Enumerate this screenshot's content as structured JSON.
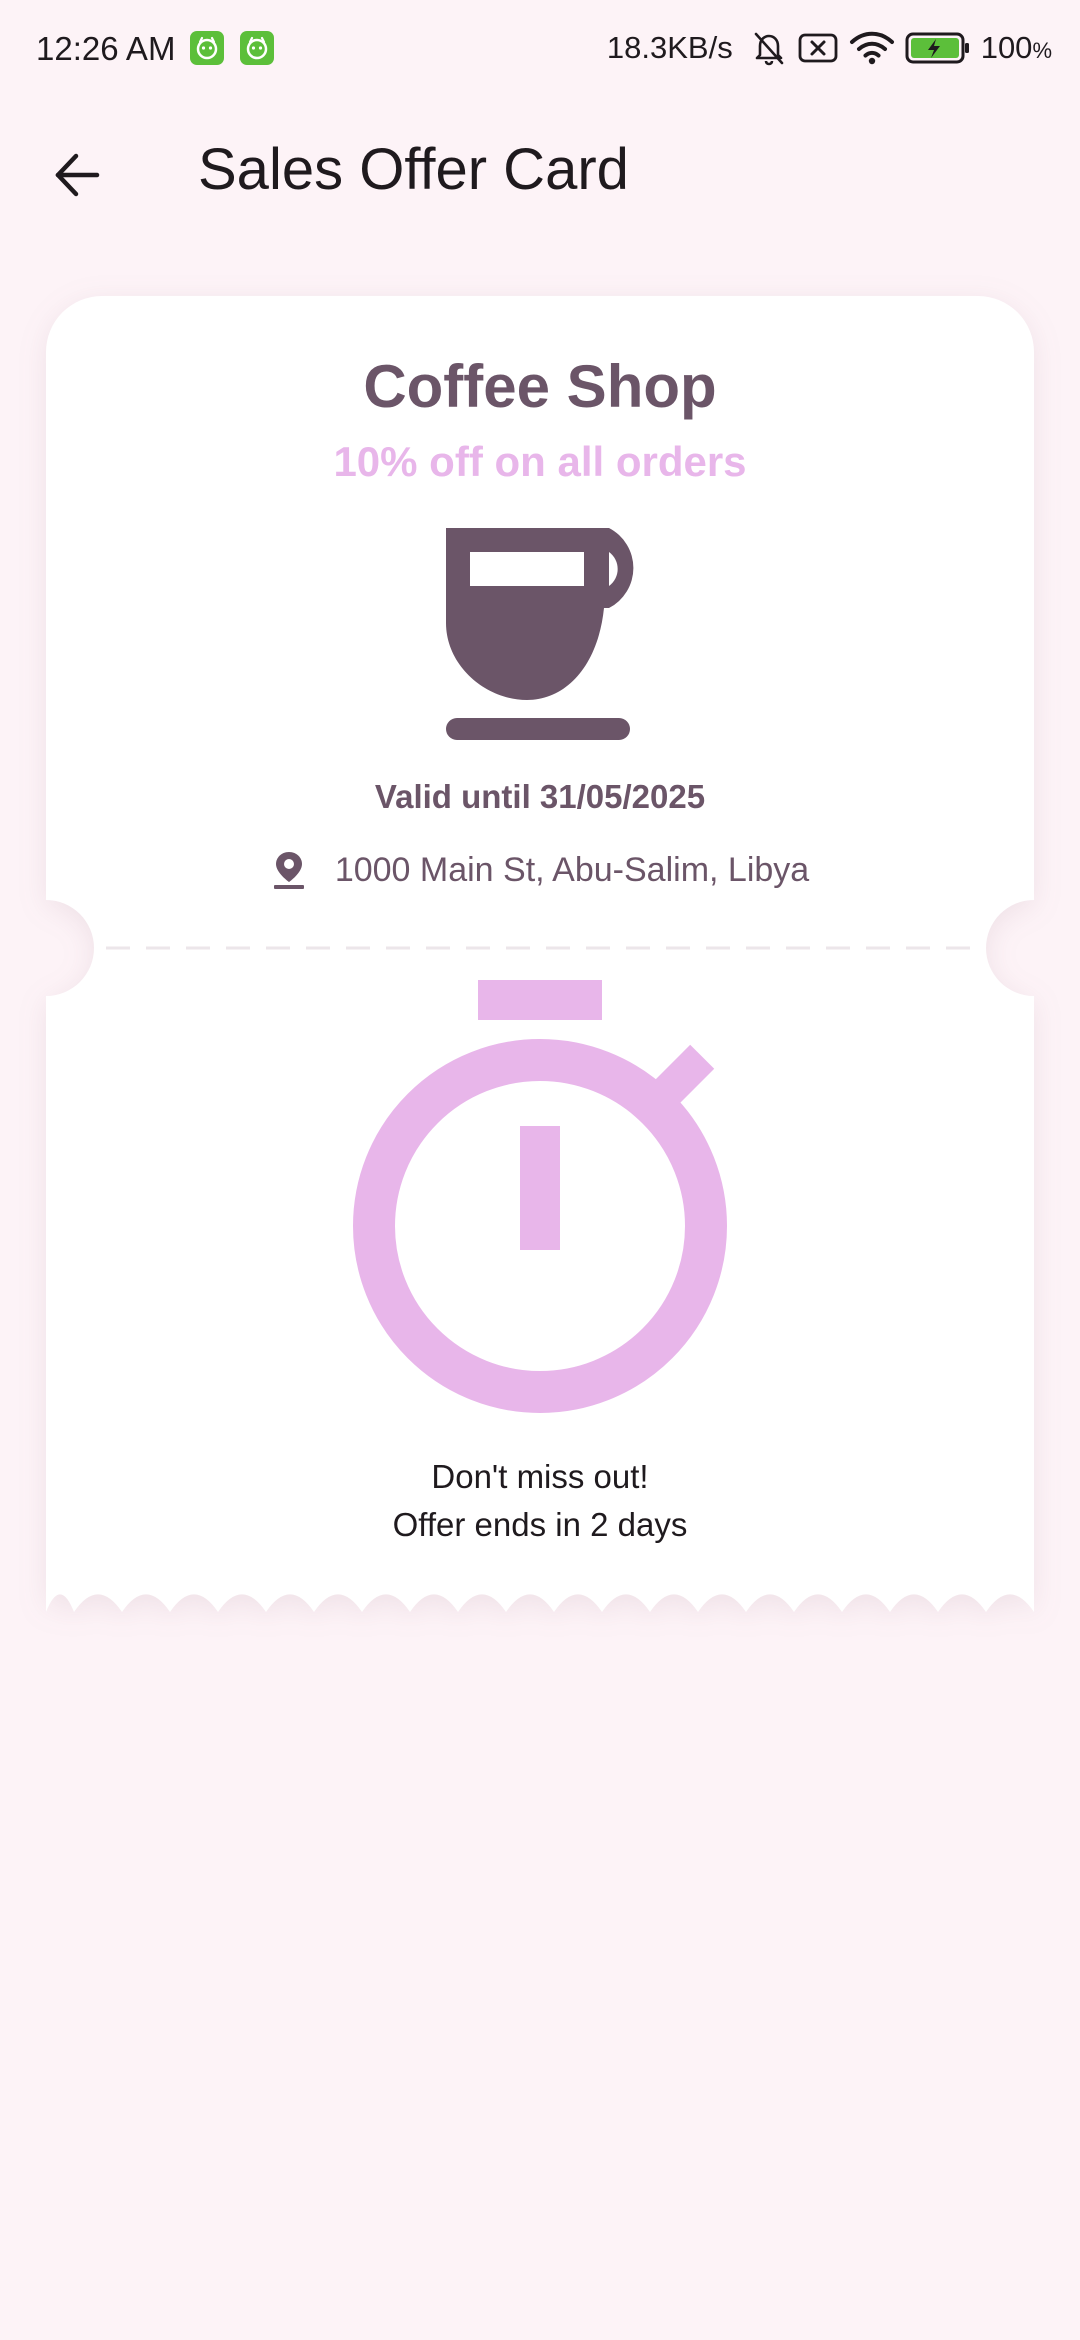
{
  "status_bar": {
    "time": "12:26 AM",
    "net_speed": "18.3KB/s",
    "battery": "100",
    "battery_unit": "%"
  },
  "app_bar": {
    "title": "Sales Offer Card"
  },
  "offer": {
    "shop_name": "Coffee Shop",
    "discount_text": "10% off on all orders",
    "valid_until": "Valid until 31/05/2025",
    "address": "1000 Main St, Abu-Salim, Libya",
    "countdown_line1": "Don't miss out!",
    "countdown_line2": "Offer ends in 2 days"
  },
  "colors": {
    "background": "#fdf3f7",
    "card": "#ffffff",
    "primary_text": "#6b5568",
    "accent": "#e8b6ea",
    "status_app_icon": "#5cbf3a"
  },
  "icons": {
    "back": "arrow-back-icon",
    "cup": "coffee-cup-icon",
    "location": "location-pin-icon",
    "timer": "stopwatch-icon"
  }
}
